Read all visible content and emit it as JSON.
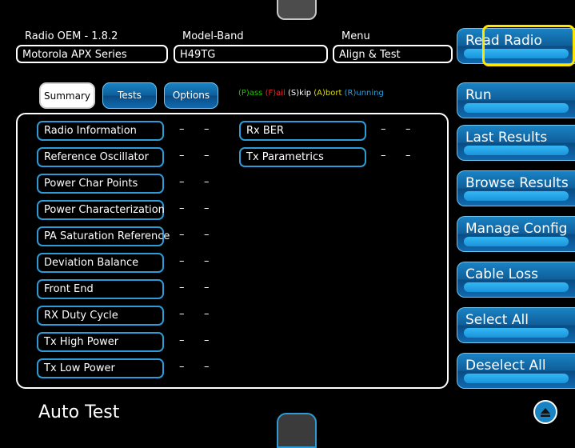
{
  "header": {
    "radio_oem_label": "Radio OEM - 1.8.2",
    "radio_oem_value": "Motorola APX Series",
    "model_band_label": "Model-Band",
    "model_band_value": "H49TG",
    "menu_label": "Menu",
    "menu_value": "Align & Test",
    "read_radio": "Read Radio"
  },
  "filter_tabs": {
    "summary": "Summary",
    "tests": "Tests",
    "options": "Options"
  },
  "legend": {
    "pass": "(P)ass",
    "fail": "(F)ail",
    "skip": "(S)kip",
    "abort": "(A)bort",
    "running": "(R)unning",
    "pass_color": "#22c000",
    "fail_color": "#ff2020",
    "skip_color": "#ffffff",
    "abort_color": "#d8d820",
    "running_color": "#2f9bd6"
  },
  "tests_left": [
    {
      "name": "Radio Information",
      "s1": "–",
      "s2": "–"
    },
    {
      "name": "Reference Oscillator",
      "s1": "–",
      "s2": "–"
    },
    {
      "name": "Power Char Points",
      "s1": "–",
      "s2": "–"
    },
    {
      "name": "Power Characterization",
      "s1": "–",
      "s2": "–"
    },
    {
      "name": "PA Saturation Reference",
      "s1": "–",
      "s2": "–"
    },
    {
      "name": "Deviation Balance",
      "s1": "–",
      "s2": "–"
    },
    {
      "name": "Front End",
      "s1": "–",
      "s2": "–"
    },
    {
      "name": "RX Duty Cycle",
      "s1": "–",
      "s2": "–"
    },
    {
      "name": "Tx High Power",
      "s1": "–",
      "s2": "–"
    },
    {
      "name": "Tx Low Power",
      "s1": "–",
      "s2": "–"
    }
  ],
  "tests_right": [
    {
      "name": "Rx BER",
      "s1": "–",
      "s2": "–"
    },
    {
      "name": "Tx Parametrics",
      "s1": "–",
      "s2": "–"
    }
  ],
  "side_buttons": {
    "run": "Run",
    "last_results": "Last Results",
    "browse_results": "Browse Results",
    "manage_config": "Manage Config",
    "cable_loss": "Cable Loss",
    "select_all": "Select All",
    "deselect_all": "Deselect All"
  },
  "page_title": "Auto Test",
  "icons": {
    "top_button": "eject-up-icon"
  }
}
